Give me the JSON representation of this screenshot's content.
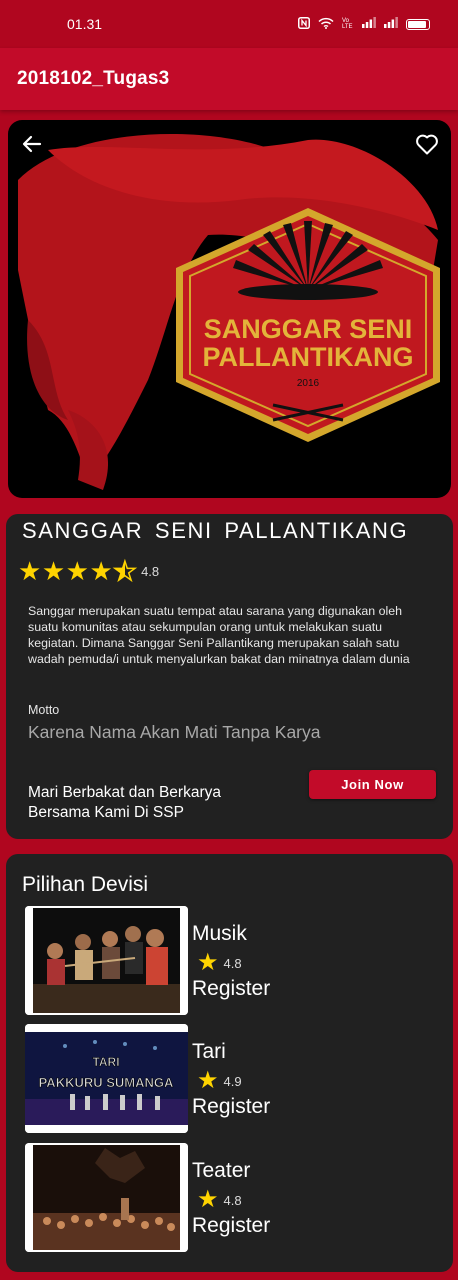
{
  "status_bar": {
    "time": "01.31",
    "icons": [
      "nfc-icon",
      "wifi-icon",
      "volte-icon",
      "signal-icon",
      "signal-icon",
      "battery-icon"
    ],
    "volte_label": "Vo LTE"
  },
  "app_bar": {
    "title": "2018102_Tugas3"
  },
  "hero": {
    "logo_line1": "SANGGAR SENI",
    "logo_line2": "PALLANTIKANG",
    "logo_year": "2016"
  },
  "info": {
    "title": "SANGGAR SENI PALLANTIKANG",
    "rating": 4.8,
    "rating_label": "4.8",
    "description": "Sanggar merupakan suatu tempat atau sarana yang digunakan oleh suatu komunitas atau sekumpulan orang untuk melakukan suatu kegiatan. Dimana Sanggar Seni Pallantikang merupakan salah satu wadah pemuda/i untuk menyalurkan bakat dan minatnya dalam dunia",
    "motto_label": "Motto",
    "motto": "Karena Nama Akan Mati Tanpa Karya",
    "cta": "Mari Berbakat dan Berkarya Bersama Kami Di SSP",
    "join_label": "Join Now"
  },
  "divisions_title": "Pilihan Devisi",
  "divisions": [
    {
      "name": "Musik",
      "rating": 4.8,
      "rating_label": "4.8",
      "register": "Register"
    },
    {
      "name": "Tari",
      "rating": 4.9,
      "rating_label": "4.9",
      "register": "Register",
      "photo_caption": "TARI PAKKURU SUMANGA"
    },
    {
      "name": "Teater",
      "rating": 4.8,
      "rating_label": "4.8",
      "register": "Register"
    }
  ],
  "colors": {
    "brand_red": "#b0061f",
    "app_bar": "#c20b29",
    "card_bg": "#212121",
    "star": "#ffd400"
  }
}
